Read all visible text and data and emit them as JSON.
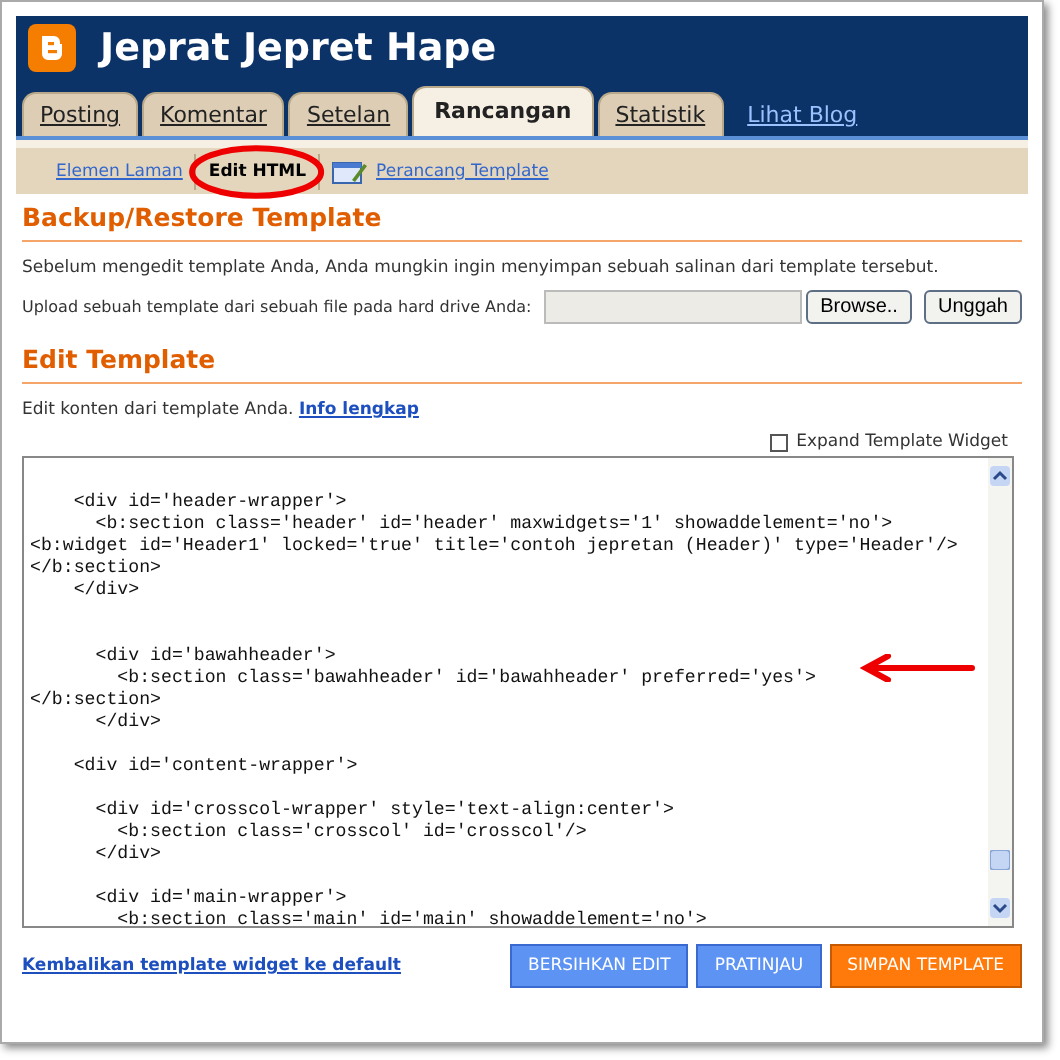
{
  "header": {
    "title": "Jeprat Jepret Hape"
  },
  "tabs": [
    {
      "label": "Posting",
      "selected": false
    },
    {
      "label": "Komentar",
      "selected": false
    },
    {
      "label": "Setelan",
      "selected": false
    },
    {
      "label": "Rancangan",
      "selected": true
    },
    {
      "label": "Statistik",
      "selected": false
    }
  ],
  "view_blog_link": "Lihat Blog",
  "subtabs": [
    {
      "label": "Elemen Laman",
      "selected": false,
      "kind": "link"
    },
    {
      "label": "Edit HTML",
      "selected": true,
      "kind": "link"
    },
    {
      "label": "Perancang Template",
      "selected": false,
      "kind": "icon-link"
    }
  ],
  "backup": {
    "heading": "Backup/Restore Template",
    "description": "Sebelum mengedit template Anda, Anda mungkin ingin menyimpan sebuah salinan dari template tersebut.",
    "upload_label": "Upload sebuah template dari sebuah file pada hard drive Anda:",
    "browse_button": "Browse..",
    "upload_button": "Unggah"
  },
  "edit": {
    "heading": "Edit Template",
    "description": "Edit konten dari template Anda.",
    "info_link": "Info lengkap",
    "expand_checkbox": {
      "label": "Expand Template Widget",
      "checked": false
    },
    "code": "    <div id='header-wrapper'>\n      <b:section class='header' id='header' maxwidgets='1' showaddelement='no'>\n<b:widget id='Header1' locked='true' title='contoh jepretan (Header)' type='Header'/>\n</b:section>\n    </div>\n\n\n      <div id='bawahheader'>\n        <b:section class='bawahheader' id='bawahheader' preferred='yes'>\n</b:section>\n      </div>\n\n    <div id='content-wrapper'>\n\n      <div id='crosscol-wrapper' style='text-align:center'>\n        <b:section class='crosscol' id='crosscol'/>\n      </div>\n\n      <div id='main-wrapper'>\n        <b:section class='main' id='main' showaddelement='no'>"
  },
  "footer": {
    "reset_link": "Kembalikan template widget ke default",
    "buttons": [
      {
        "label": "BERSIHKAN EDIT",
        "kind": "secondary"
      },
      {
        "label": "PRATINJAU",
        "kind": "secondary"
      },
      {
        "label": "SIMPAN TEMPLATE",
        "kind": "primary"
      }
    ]
  }
}
